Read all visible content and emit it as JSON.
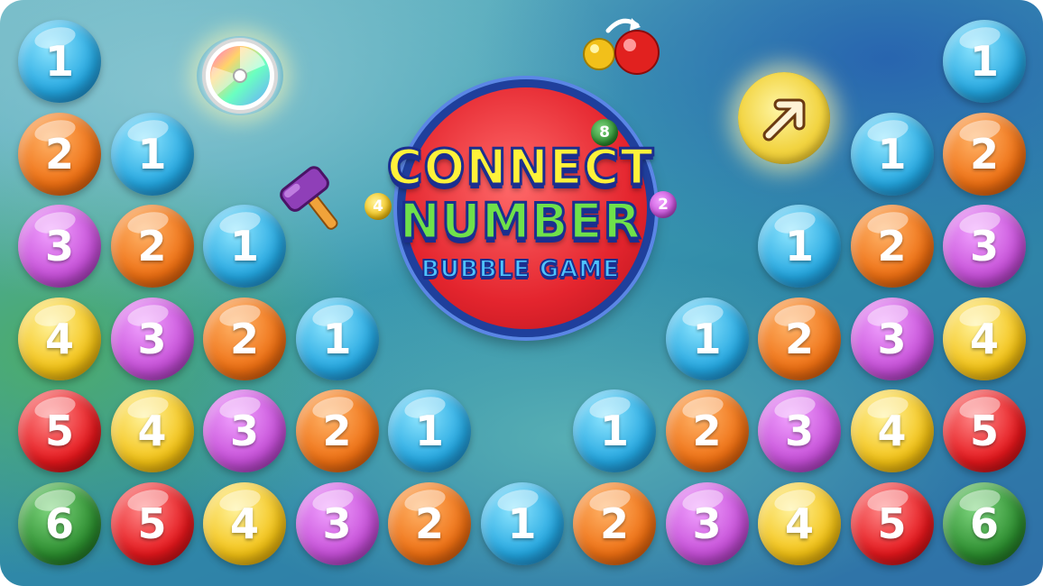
{
  "logo": {
    "title_line1": "CONNECT",
    "title_line2": "NUMBER",
    "subtitle": "BUBBLE GAME",
    "mini_bubbles": [
      "8",
      "4",
      "2"
    ]
  },
  "boosters": {
    "shuffle": "rainbow-spinner-icon",
    "hammer": "hammer-icon",
    "swap": "color-swap-icon",
    "hint": "arrow-hint-icon"
  },
  "colors": {
    "1": "#23a6e0",
    "2": "#ee6f12",
    "3": "#c64fd8",
    "4": "#f3c214",
    "5": "#e5171c",
    "6": "#2b8c2e"
  },
  "board": {
    "rows": [
      {
        "left": [
          "1"
        ],
        "right": [
          "1"
        ]
      },
      {
        "left": [
          "2",
          "1"
        ],
        "right": [
          "1",
          "2"
        ]
      },
      {
        "left": [
          "3",
          "2",
          "1"
        ],
        "right": [
          "1",
          "2",
          "3"
        ]
      },
      {
        "left": [
          "4",
          "3",
          "2",
          "1"
        ],
        "right": [
          "1",
          "2",
          "3",
          "4"
        ]
      },
      {
        "left": [
          "5",
          "4",
          "3",
          "2",
          "1"
        ],
        "right": [
          "1",
          "2",
          "3",
          "4",
          "5"
        ]
      },
      {
        "full": [
          "6",
          "5",
          "4",
          "3",
          "2",
          "1",
          "2",
          "3",
          "4",
          "5",
          "6"
        ]
      }
    ]
  }
}
